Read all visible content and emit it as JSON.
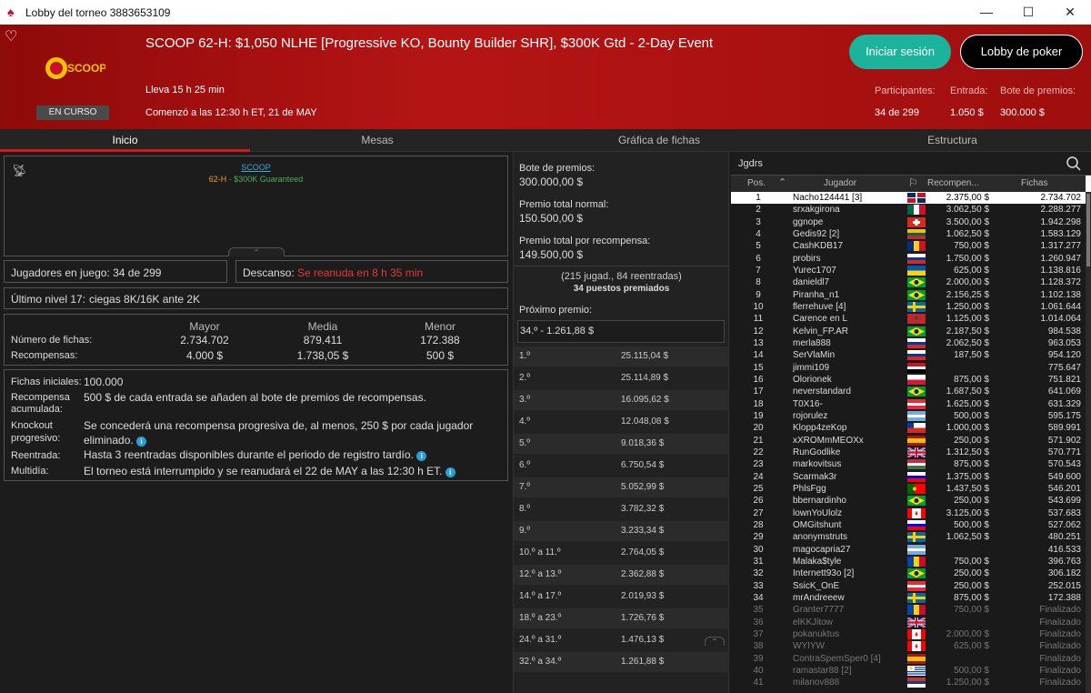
{
  "window": {
    "title": "Lobby del torneo 3883653109"
  },
  "header": {
    "title": "SCOOP 62-H: $1,050 NLHE [Progressive KO, Bounty Builder SHR], $300K Gtd - 2-Day Event",
    "elapsed": "Lleva 15 h 25 min",
    "started": "Comenzó a las 12:30 h ET, 21 de MAY",
    "status_badge": "EN CURSO",
    "login_label": "Iniciar sesión",
    "lobby_label": "Lobby de poker",
    "logo_text": "SCOOP",
    "participants_label": "Participantes:",
    "participants_value": "34 de 299",
    "entry_label": "Entrada:",
    "entry_value": "1.050 $",
    "prizepool_label": "Bote de premios:",
    "prizepool_value": "300.000 $"
  },
  "tabs": [
    "Inicio",
    "Mesas",
    "Gráfica de fichas",
    "Estructura"
  ],
  "info": {
    "scoop_link": "SCOOP",
    "event_code": "62-H",
    "event_sep": " - ",
    "event_gtd": "$300K Guaranteed",
    "players_in_game": "Jugadores en juego: 34 de 299",
    "break_label": "Descanso: ",
    "break_value": "Se reanuda en 8 h 35 min",
    "last_level_label": "Último nivel 17:",
    "last_level_value": "ciegas 8K/16K ante 2K",
    "stats": {
      "col_major": "Mayor",
      "col_avg": "Media",
      "col_minor": "Menor",
      "chips_label": "Número de fichas:",
      "chips_major": "2.734.702",
      "chips_avg": "879.411",
      "chips_minor": "172.388",
      "rewards_label": "Recompensas:",
      "rewards_major": "4.000 $",
      "rewards_avg": "1.738,05 $",
      "rewards_minor": "500 $"
    },
    "details": [
      {
        "label": "Fichas iniciales:",
        "value": "100.000"
      },
      {
        "label": "Recompensa acumulada:",
        "value": "500 $ de cada entrada se añaden al bote de premios de recompensas."
      },
      {
        "label": "Knockout progresivo:",
        "value": "Se concederá una recompensa progresiva de, al menos, 250 $ por cada jugador eliminado."
      },
      {
        "label": "Reentrada:",
        "value": "Hasta 3 reentradas disponibles durante el periodo de registro tardío."
      },
      {
        "label": "Multidía:",
        "value": "El torneo está interrumpido y se reanudará el 22 de MAY a las 12:30 h ET."
      }
    ]
  },
  "prizes": {
    "pool_label": "Bote de premios:",
    "pool_value": "300.000,00 $",
    "normal_label": "Premio total normal:",
    "normal_value": "150.500,00 $",
    "bounty_label": "Premio total por recompensa:",
    "bounty_value": "149.500,00 $",
    "entries_text": "(215 jugad., 84 reentradas)",
    "paid_text": "34 puestos premiados",
    "next_label": "Próximo premio:",
    "next_value": "34.º - 1.261,88 $",
    "places": [
      {
        "p": "1.º",
        "a": "25.115,04 $"
      },
      {
        "p": "2.º",
        "a": "25.114,89 $"
      },
      {
        "p": "3.º",
        "a": "16.095,62 $"
      },
      {
        "p": "4.º",
        "a": "12.048,08 $"
      },
      {
        "p": "5.º",
        "a": "9.018,36 $"
      },
      {
        "p": "6.º",
        "a": "6.750,54 $"
      },
      {
        "p": "7.º",
        "a": "5.052,99 $"
      },
      {
        "p": "8.º",
        "a": "3.782,32 $"
      },
      {
        "p": "9.º",
        "a": "3.233,34 $"
      },
      {
        "p": "10.º a 11.º",
        "a": "2.764,05 $"
      },
      {
        "p": "12.º a 13.º",
        "a": "2.362,88 $"
      },
      {
        "p": "14.º a 17.º",
        "a": "2.019,93 $"
      },
      {
        "p": "18.º a 23.º",
        "a": "1.726,76 $"
      },
      {
        "p": "24.º a 31.º",
        "a": "1.476,13 $"
      },
      {
        "p": "32.º a 34.º",
        "a": "1.261,88 $"
      }
    ]
  },
  "players": {
    "search_value": "Jgdrs",
    "col_pos": "Pos.",
    "col_player": "Jugador",
    "col_reward": "Recompen...",
    "col_chips": "Fichas",
    "rows": [
      {
        "pos": "1",
        "name": "Nacho124441 [3]",
        "reward": "2.375,00 $",
        "chips": "2.734.702",
        "flag": "do"
      },
      {
        "pos": "2",
        "name": "srxakgirona",
        "reward": "3.062,50 $",
        "chips": "2.288.277",
        "flag": "mx"
      },
      {
        "pos": "3",
        "name": "ggnope",
        "reward": "3.500,00 $",
        "chips": "1.942.298",
        "flag": "ch"
      },
      {
        "pos": "4",
        "name": "Gedis92 [2]",
        "reward": "1.062,50 $",
        "chips": "1.583.129",
        "flag": "lt"
      },
      {
        "pos": "5",
        "name": "CashKDB17",
        "reward": "750,00 $",
        "chips": "1.317.277",
        "flag": "ro"
      },
      {
        "pos": "6",
        "name": "probirs",
        "reward": "1.750,00 $",
        "chips": "1.260.947",
        "flag": "ru"
      },
      {
        "pos": "7",
        "name": "Yurec1707",
        "reward": "625,00 $",
        "chips": "1.138.816",
        "flag": "ua"
      },
      {
        "pos": "8",
        "name": "danieldl7",
        "reward": "2.000,00 $",
        "chips": "1.128.372",
        "flag": "br"
      },
      {
        "pos": "9",
        "name": "Piranha_n1",
        "reward": "2.156,25 $",
        "chips": "1.102.138",
        "flag": "br"
      },
      {
        "pos": "10",
        "name": "flerrehuve [4]",
        "reward": "1.250,00 $",
        "chips": "1.061.644",
        "flag": "se"
      },
      {
        "pos": "11",
        "name": "Carence en L",
        "reward": "1.125,00 $",
        "chips": "1.014.064",
        "flag": "ma"
      },
      {
        "pos": "12",
        "name": "Kelvin_FP.AR",
        "reward": "2.187,50 $",
        "chips": "984.538",
        "flag": "br"
      },
      {
        "pos": "13",
        "name": "merla888",
        "reward": "2.062,50 $",
        "chips": "963.053",
        "flag": "ru"
      },
      {
        "pos": "14",
        "name": "SerVlaMin",
        "reward": "187,50 $",
        "chips": "954.120",
        "flag": "ru"
      },
      {
        "pos": "15",
        "name": "jimmi109",
        "reward": "",
        "chips": "775.647",
        "flag": "iq"
      },
      {
        "pos": "16",
        "name": "Olorionek",
        "reward": "875,00 $",
        "chips": "751.821",
        "flag": "pl"
      },
      {
        "pos": "17",
        "name": "neverstandard",
        "reward": "1.687,50 $",
        "chips": "641.069",
        "flag": "br"
      },
      {
        "pos": "18",
        "name": "T0X16-",
        "reward": "1.625,00 $",
        "chips": "631.329",
        "flag": "at"
      },
      {
        "pos": "19",
        "name": "rojorulez",
        "reward": "500,00 $",
        "chips": "595.175",
        "flag": "ar"
      },
      {
        "pos": "20",
        "name": "Klopp4zeKop",
        "reward": "1.000,00 $",
        "chips": "589.991",
        "flag": "cl"
      },
      {
        "pos": "21",
        "name": "xXROMmMEOXx",
        "reward": "250,00 $",
        "chips": "571.902",
        "flag": "es"
      },
      {
        "pos": "22",
        "name": "RunGodlike",
        "reward": "1.312,50 $",
        "chips": "570.771",
        "flag": "gb"
      },
      {
        "pos": "23",
        "name": "markovitsus",
        "reward": "875,00 $",
        "chips": "570.543",
        "flag": "hu"
      },
      {
        "pos": "24",
        "name": "Scarmak3r",
        "reward": "1.375,00 $",
        "chips": "549.600",
        "flag": "si"
      },
      {
        "pos": "25",
        "name": "PhlsFgg",
        "reward": "1.437,50 $",
        "chips": "546.201",
        "flag": "pt"
      },
      {
        "pos": "26",
        "name": "bbernardinho",
        "reward": "250,00 $",
        "chips": "543.699",
        "flag": "br"
      },
      {
        "pos": "27",
        "name": "lownYoUlolz",
        "reward": "3.125,00 $",
        "chips": "537.683",
        "flag": "ca"
      },
      {
        "pos": "28",
        "name": "OMGitshunt",
        "reward": "500,00 $",
        "chips": "527.062",
        "flag": "si"
      },
      {
        "pos": "29",
        "name": "anonymstruts",
        "reward": "1.062,50 $",
        "chips": "480.251",
        "flag": "se"
      },
      {
        "pos": "30",
        "name": "magocapria27",
        "reward": "",
        "chips": "416.533",
        "flag": "ar"
      },
      {
        "pos": "31",
        "name": "Malaka$tyle",
        "reward": "750,00 $",
        "chips": "396.763",
        "flag": "md"
      },
      {
        "pos": "32",
        "name": "Internett93o [2]",
        "reward": "250,00 $",
        "chips": "306.182",
        "flag": "br"
      },
      {
        "pos": "33",
        "name": "SsicK_OnE",
        "reward": "250,00 $",
        "chips": "252.015",
        "flag": "at"
      },
      {
        "pos": "34",
        "name": "mrAndreeew",
        "reward": "875,00 $",
        "chips": "172.388",
        "flag": "se"
      },
      {
        "pos": "35",
        "name": "Granter7777",
        "reward": "750,00 $",
        "chips": "Finalizado",
        "flag": "md"
      },
      {
        "pos": "36",
        "name": "elKKJitow",
        "reward": "",
        "chips": "Finalizado",
        "flag": "gb"
      },
      {
        "pos": "37",
        "name": "pokanuktus",
        "reward": "2.000,00 $",
        "chips": "Finalizado",
        "flag": "ca"
      },
      {
        "pos": "38",
        "name": "WYIYW",
        "reward": "625,00 $",
        "chips": "Finalizado",
        "flag": "ca"
      },
      {
        "pos": "39",
        "name": "ContraSpemSper0 [4]",
        "reward": "",
        "chips": "Finalizado",
        "flag": "es"
      },
      {
        "pos": "40",
        "name": "ramastar88 [2]",
        "reward": "500,00 $",
        "chips": "Finalizado",
        "flag": "uy"
      },
      {
        "pos": "41",
        "name": "milanov888",
        "reward": "1.250,00 $",
        "chips": "Finalizado",
        "flag": "rs"
      }
    ]
  }
}
